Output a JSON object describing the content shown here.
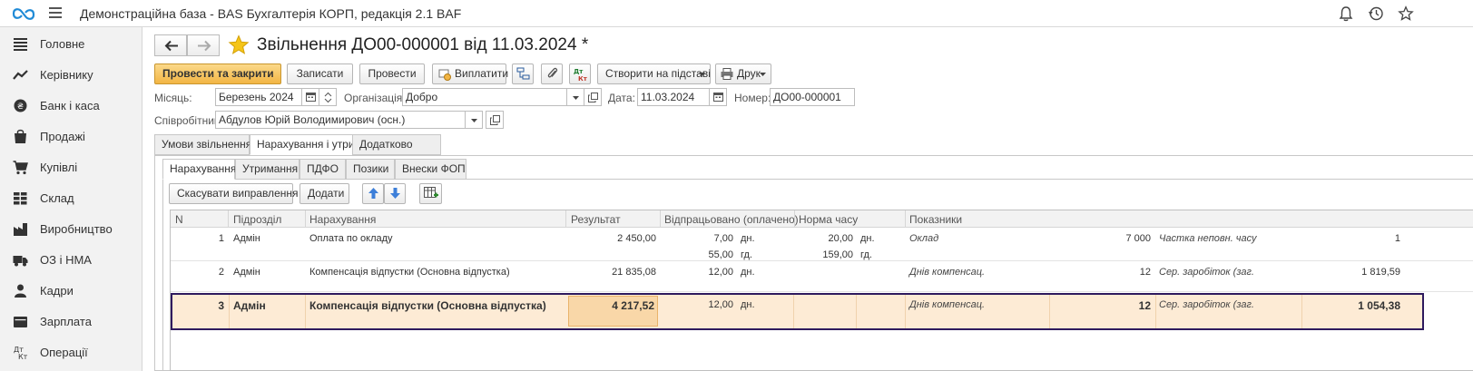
{
  "app": {
    "title": "Демонстраційна база - BAS Бухгалтерія КОРП, редакція 2.1 BAF"
  },
  "sidebar": {
    "items": [
      {
        "label": "Головне",
        "icon": "menu-lines-icon"
      },
      {
        "label": "Керівнику",
        "icon": "trend-icon"
      },
      {
        "label": "Банк і каса",
        "icon": "coins-icon"
      },
      {
        "label": "Продажі",
        "icon": "bag-icon"
      },
      {
        "label": "Купівлі",
        "icon": "cart-icon"
      },
      {
        "label": "Склад",
        "icon": "grid-icon"
      },
      {
        "label": "Виробництво",
        "icon": "factory-icon"
      },
      {
        "label": "ОЗ і НМА",
        "icon": "truck-icon"
      },
      {
        "label": "Кадри",
        "icon": "person-icon"
      },
      {
        "label": "Зарплата",
        "icon": "wallet-icon"
      },
      {
        "label": "Операції",
        "icon": "dt-kt-icon"
      }
    ]
  },
  "document": {
    "title": "Звільнення ДО00-000001 від 11.03.2024 *"
  },
  "toolbar": {
    "post_close": "Провести та закрити",
    "save": "Записати",
    "post": "Провести",
    "pay": "Виплатити",
    "create_based": "Створити на підставі",
    "print": "Друк"
  },
  "form": {
    "month_label": "Місяць:",
    "month_value": "Березень 2024",
    "org_label": "Організація:",
    "org_value": "Добро",
    "date_label": "Дата:",
    "date_value": "11.03.2024",
    "number_label": "Номер:",
    "number_value": "ДО00-000001",
    "employee_label": "Співробітник:",
    "employee_value": "Абдулов Юрій Володимирович (осн.)"
  },
  "tabs": [
    "Умови звільнення",
    "Нарахування і утримання",
    "Додатково"
  ],
  "subtabs": [
    "Нарахування",
    "Утримання",
    "ПДФО",
    "Позики",
    "Внески ФОП"
  ],
  "table_toolbar": {
    "cancel_corrections": "Скасувати виправлення",
    "add": "Додати"
  },
  "table": {
    "headers": [
      "N",
      "Підрозділ",
      "Нарахування",
      "Результат",
      "Відпрацьовано (оплачено)",
      "Норма часу",
      "Показники"
    ],
    "rows": [
      {
        "n": "1",
        "dept": "Адмін",
        "accrual": "Оплата по окладу",
        "result": "2 450,00",
        "worked1": "7,00",
        "unit1": "дн.",
        "worked2": "55,00",
        "unit2": "гд.",
        "norm1": "20,00",
        "nunit1": "дн.",
        "norm2": "159,00",
        "nunit2": "гд.",
        "ind1_name": "Оклад",
        "ind1_val": "7 000",
        "ind2_name": "Частка неповн. часу",
        "ind2_val": "1"
      },
      {
        "n": "2",
        "dept": "Адмін",
        "accrual": "Компенсація відпустки (Основна відпустка)",
        "result": "21 835,08",
        "worked1": "12,00",
        "unit1": "дн.",
        "ind1_name": "Днів компенсац.",
        "ind1_val": "12",
        "ind2_name": "Сер. заробіток (заг.",
        "ind2_val": "1 819,59"
      },
      {
        "n": "3",
        "dept": "Адмін",
        "accrual": "Компенсація відпустки (Основна відпустка)",
        "result": "4 217,52",
        "worked1": "12,00",
        "unit1": "дн.",
        "ind1_name": "Днів компенсац.",
        "ind1_val": "12",
        "ind2_name": "Сер. заробіток (заг.",
        "ind2_val": "1 054,38"
      }
    ]
  },
  "colors": {
    "accent": "#f2b544",
    "selection_border": "#2e1a5e",
    "selection_bg": "#fdebd5"
  }
}
